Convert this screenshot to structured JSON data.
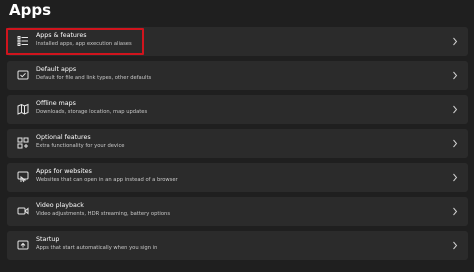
{
  "page": {
    "title": "Apps"
  },
  "items": [
    {
      "title": "Apps & features",
      "subtitle": "Installed apps, app execution aliases",
      "icon": "apps-list-icon"
    },
    {
      "title": "Default apps",
      "subtitle": "Default for file and link types, other defaults",
      "icon": "default-apps-icon"
    },
    {
      "title": "Offline maps",
      "subtitle": "Downloads, storage location, map updates",
      "icon": "offline-maps-icon"
    },
    {
      "title": "Optional features",
      "subtitle": "Extra functionality for your device",
      "icon": "optional-features-icon"
    },
    {
      "title": "Apps for websites",
      "subtitle": "Websites that can open in an app instead of a browser",
      "icon": "apps-for-websites-icon"
    },
    {
      "title": "Video playback",
      "subtitle": "Video adjustments, HDR streaming, battery options",
      "icon": "video-playback-icon"
    },
    {
      "title": "Startup",
      "subtitle": "Apps that start automatically when you sign in",
      "icon": "startup-icon"
    }
  ],
  "colors": {
    "background": "#1f1f1f",
    "card": "#2b2b2b",
    "highlight": "#d0141d"
  }
}
